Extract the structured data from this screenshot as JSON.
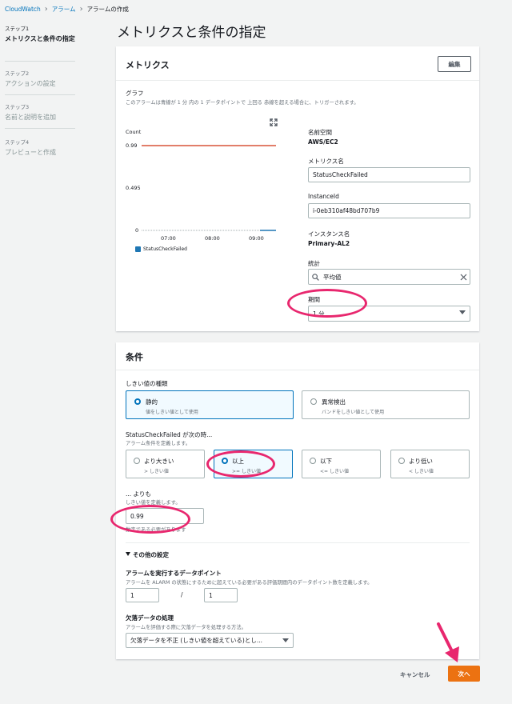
{
  "breadcrumb": {
    "root": "CloudWatch",
    "alarms": "アラーム",
    "current": "アラームの作成"
  },
  "steps": [
    {
      "num": "ステップ1",
      "title": "メトリクスと条件の指定"
    },
    {
      "num": "ステップ2",
      "title": "アクションの設定"
    },
    {
      "num": "ステップ3",
      "title": "名前と説明を追加"
    },
    {
      "num": "ステップ4",
      "title": "プレビューと作成"
    }
  ],
  "page_title": "メトリクスと条件の指定",
  "metrics_panel": {
    "header": "メトリクス",
    "edit_button": "編集",
    "graph_label": "グラフ",
    "graph_desc": "このアラームは青線が 1 分 内の 1 データポイントで 上回る 赤線を超える場合に、トリガーされます。",
    "namespace_label": "名前空間",
    "namespace_value": "AWS/EC2",
    "metric_name_label": "メトリクス名",
    "metric_name_value": "StatusCheckFailed",
    "instance_id_label": "InstanceId",
    "instance_id_value": "i-0eb310af48bd707b9",
    "instance_name_label": "インスタンス名",
    "instance_name_value": "Primary-AL2",
    "statistic_label": "統計",
    "statistic_value": "平均値",
    "period_label": "期間",
    "period_value": "1 分"
  },
  "chart_data": {
    "type": "line",
    "ylabel": "Count",
    "y_ticks": [
      "0.99",
      "0.495",
      "0"
    ],
    "x_ticks": [
      "07:00",
      "08:00",
      "09:00"
    ],
    "ylim": [
      0,
      0.99
    ],
    "threshold": 0.99,
    "series": [
      {
        "name": "StatusCheckFailed",
        "values": [
          0,
          0
        ]
      }
    ],
    "colors": {
      "threshold": "#d13212",
      "series": "#1f77b4"
    }
  },
  "conditions_panel": {
    "header": "条件",
    "threshold_type_label": "しきい値の種類",
    "static_title": "静的",
    "static_desc": "値をしきい値として使用",
    "anomaly_title": "異常検出",
    "anomaly_desc": "バンドをしきい値として使用",
    "when_label": "StatusCheckFailed が次の時...",
    "when_desc": "アラーム条件を定義します。",
    "ops": [
      {
        "title": "より大きい",
        "desc": "> しきい値"
      },
      {
        "title": "以上",
        "desc": ">= しきい値"
      },
      {
        "title": "以下",
        "desc": "<= しきい値"
      },
      {
        "title": "より低い",
        "desc": "< しきい値"
      }
    ],
    "than_label": "... よりも",
    "than_desc": "しきい値を定義します。",
    "threshold_value": "0.99",
    "number_hint": "数字である必要があります",
    "other_settings": "その他の設定",
    "datapoints_label": "アラームを実行するデータポイント",
    "datapoints_desc": "アラームを ALARM の状態にするために超えている必要がある評価期間内のデータポイント数を定義します。",
    "datapoints_m": "1",
    "datapoints_slash": "/",
    "datapoints_n": "1",
    "missing_label": "欠落データの処理",
    "missing_desc": "アラームを評価する際に欠落データを処理する方法。",
    "missing_value": "欠落データを不正 (しきい値を超えている)とし..."
  },
  "footer": {
    "cancel": "キャンセル",
    "next": "次へ"
  },
  "colors": {
    "accent": "#0073bb",
    "annotation": "#e8276e",
    "primary_button": "#ec7211"
  }
}
